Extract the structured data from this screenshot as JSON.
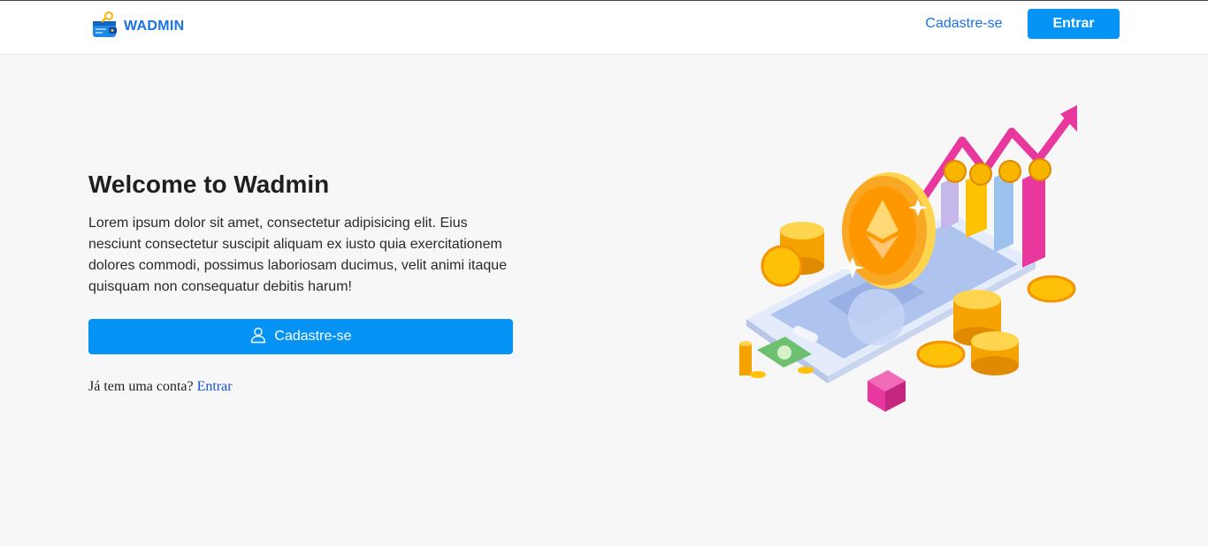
{
  "navbar": {
    "brand_name": "WADMIN",
    "signup_link": "Cadastre-se",
    "login_button": "Entrar"
  },
  "hero": {
    "title": "Welcome to Wadmin",
    "paragraph": "Lorem ipsum dolor sit amet, consectetur adipisicing elit. Eius nesciunt consectetur suscipit aliquam ex iusto quia exercitationem dolores commodi, possimus laboriosam ducimus, velit animi itaque quisquam non consequatur debitis harum!",
    "cta_label": "Cadastre-se",
    "cta_icon": "user-icon",
    "login_prompt": "Já tem uma conta?",
    "login_link": "Entrar"
  },
  "colors": {
    "primary": "#0593f5",
    "link": "#1a73e8",
    "background": "#f7f7f7",
    "coin_gold": "#f7b500",
    "chart_pink": "#e8389e"
  },
  "illustration": {
    "icon": "crypto-phone-illustration"
  }
}
